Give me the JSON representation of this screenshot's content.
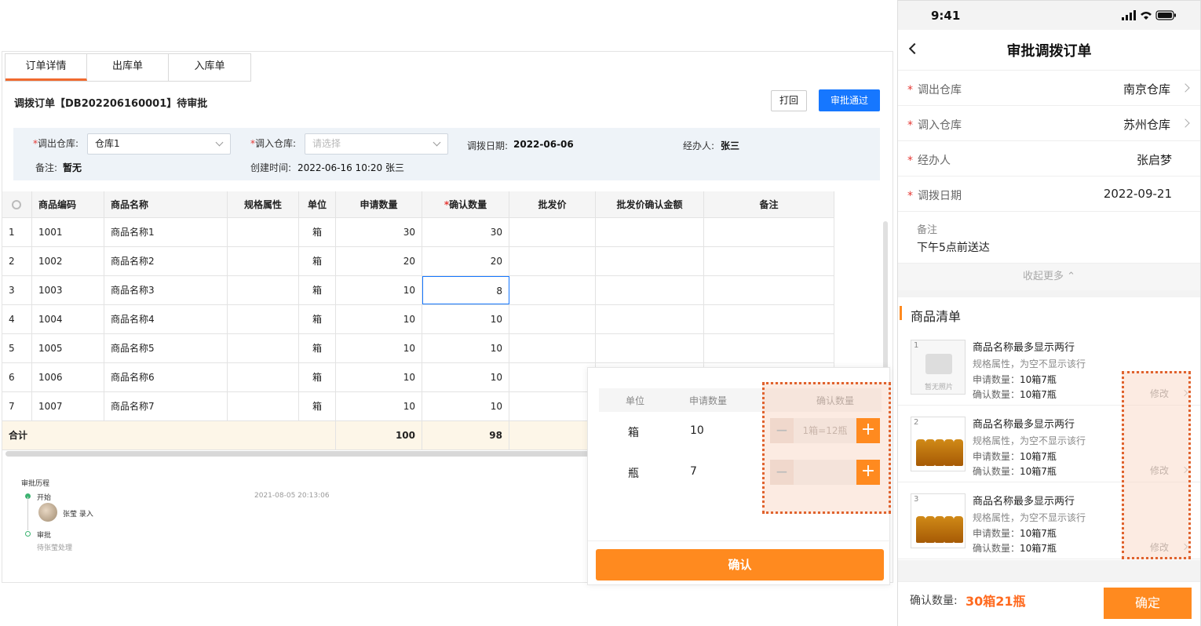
{
  "desktop": {
    "tabs": [
      "订单详情",
      "出库单",
      "入库单"
    ],
    "title": "调拨订单【DB202206160001】待审批",
    "print_label": "打回",
    "approve_label": "审批通过",
    "form": {
      "out_wh_label": "调出仓库:",
      "out_wh_value": "仓库1",
      "in_wh_label": "调入仓库:",
      "in_wh_placeholder": "请选择",
      "date_label": "调拨日期:",
      "date_value": "2022-06-06",
      "handler_label": "经办人:",
      "handler_value": "张三",
      "remark_label": "备注:",
      "remark_value": "暂无",
      "created_label": "创建时间:",
      "created_value": "2022-06-16 10:20 张三",
      "required_mark": "*"
    },
    "table": {
      "headers": [
        "商品编码",
        "商品名称",
        "规格属性",
        "单位",
        "申请数量",
        "确认数量",
        "批发价",
        "批发价确认金额",
        "备注"
      ],
      "rows": [
        {
          "idx": "1",
          "code": "1001",
          "name": "商品名称1",
          "unit": "箱",
          "req": "30",
          "conf": "30"
        },
        {
          "idx": "2",
          "code": "1002",
          "name": "商品名称2",
          "unit": "箱",
          "req": "20",
          "conf": "20"
        },
        {
          "idx": "3",
          "code": "1003",
          "name": "商品名称3",
          "unit": "箱",
          "req": "10",
          "conf": "8"
        },
        {
          "idx": "4",
          "code": "1004",
          "name": "商品名称4",
          "unit": "箱",
          "req": "10",
          "conf": "10"
        },
        {
          "idx": "5",
          "code": "1005",
          "name": "商品名称5",
          "unit": "箱",
          "req": "10",
          "conf": "10"
        },
        {
          "idx": "6",
          "code": "1006",
          "name": "商品名称6",
          "unit": "箱",
          "req": "10",
          "conf": "10"
        },
        {
          "idx": "7",
          "code": "1007",
          "name": "商品名称7",
          "unit": "箱",
          "req": "10",
          "conf": "10"
        }
      ],
      "total_label": "合计",
      "total_req": "100",
      "total_conf": "98"
    },
    "history": {
      "title": "审批历程",
      "start_label": "开始",
      "start_time": "2021-08-05 20:13:06",
      "entry_user": "张莹 录入",
      "approve_label": "审批",
      "approve_pending": "待张莹处理",
      "colors": {
        "done": "#3cb371",
        "pending": "#3cb371"
      }
    },
    "popup": {
      "headers": [
        "单位",
        "申请数量",
        "确认数量"
      ],
      "rows": [
        {
          "unit": "箱",
          "qty": "10",
          "placeholder": "1箱=12瓶"
        },
        {
          "unit": "瓶",
          "qty": "7",
          "placeholder": ""
        }
      ],
      "minus": "−",
      "plus": "+",
      "confirm_label": "确认"
    }
  },
  "mobile": {
    "time": "9:41",
    "title": "审批调拨订单",
    "form": [
      {
        "label": "调出仓库",
        "value": "南京仓库",
        "arrow": true
      },
      {
        "label": "调入仓库",
        "value": "苏州仓库",
        "arrow": true
      },
      {
        "label": "经办人",
        "value": "张启梦",
        "arrow": false
      },
      {
        "label": "调拨日期",
        "value": "2022-09-21",
        "arrow": false
      }
    ],
    "remark_label": "备注",
    "remark_value": "下午5点前送达",
    "collapse_label": "收起更多 ⌃",
    "goods_title": "商品清单",
    "items": [
      {
        "idx": "1",
        "name": "商品名称最多显示两行",
        "spec": "规格属性，为空不显示该行",
        "req_label": "申请数量：",
        "req": "10箱7瓶",
        "conf_label": "确认数量：",
        "conf": "10箱7瓶",
        "edit": "修改",
        "no_photo": "暂无照片"
      },
      {
        "idx": "2",
        "name": "商品名称最多显示两行",
        "spec": "规格属性，为空不显示该行",
        "req_label": "申请数量：",
        "req": "10箱7瓶",
        "conf_label": "确认数量：",
        "conf": "10箱7瓶",
        "edit": "修改"
      },
      {
        "idx": "3",
        "name": "商品名称最多显示两行",
        "spec": "规格属性，为空不显示该行",
        "req_label": "申请数量：",
        "req": "10箱7瓶",
        "conf_label": "确认数量：",
        "conf": "10箱7瓶",
        "edit": "修改"
      }
    ],
    "footer_label": "确认数量:",
    "footer_value": "30箱21瓶",
    "ok_label": "确定",
    "colors": {
      "accent": "#ff8a1f",
      "highlight": "#e0622d"
    }
  }
}
